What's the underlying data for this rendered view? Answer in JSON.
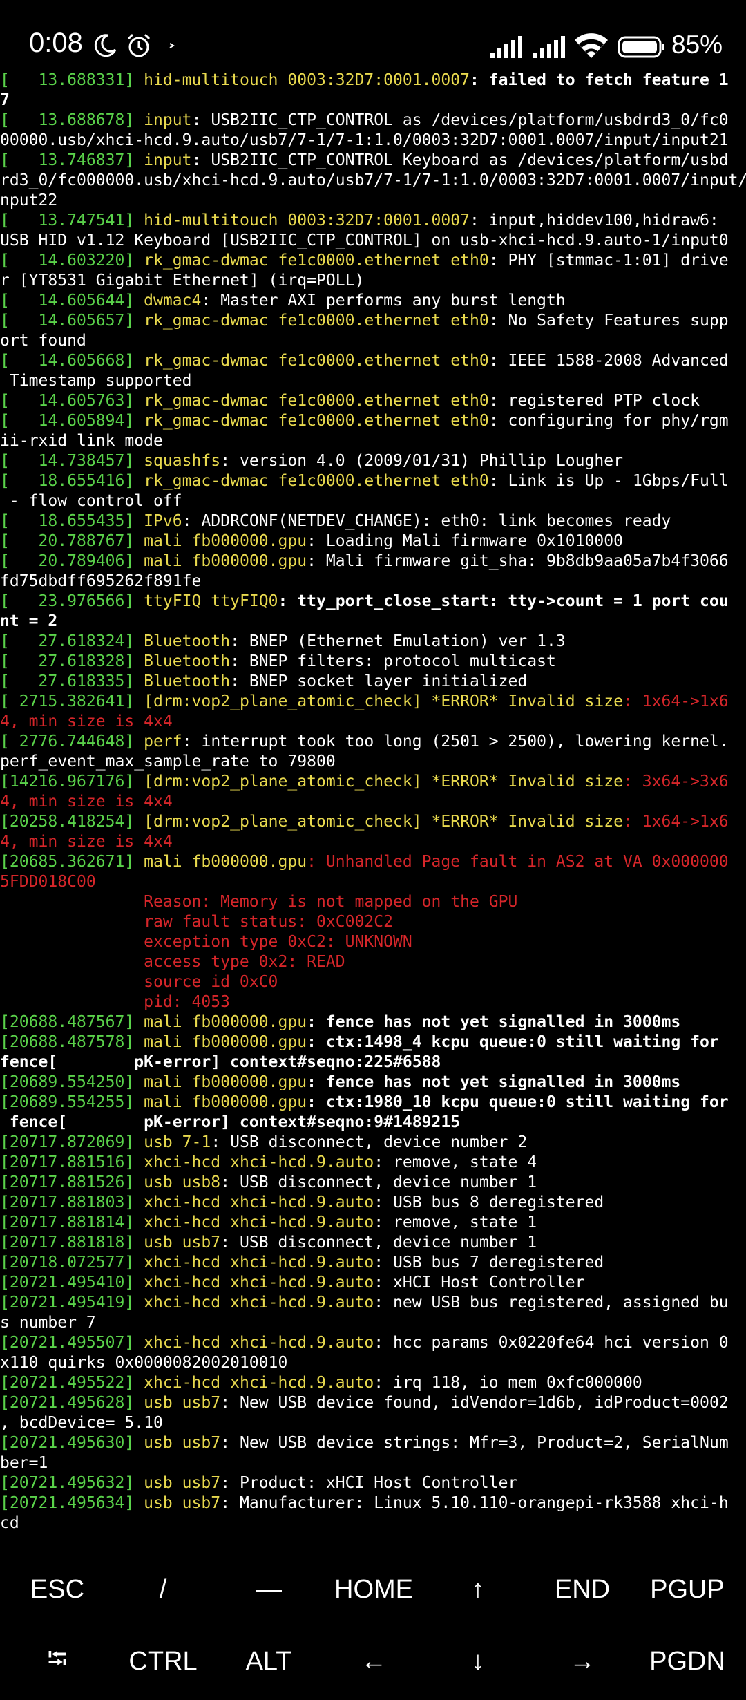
{
  "status_bar": {
    "time": "0:08",
    "battery_percent": "85%",
    "icons": [
      "moon-icon",
      "alarm-icon",
      "notification-dot-icon",
      "signal-1-icon",
      "signal-2-icon",
      "wifi-icon",
      "battery-icon"
    ]
  },
  "colors": {
    "background": "#000000",
    "green": "#5ad24a",
    "yellow": "#e8d94e",
    "red": "#d6262a",
    "white": "#ffffff"
  },
  "terminal": {
    "lines": [
      [
        [
          "g",
          "[   13.688331] "
        ],
        [
          "y",
          "hid-multitouch 0003:32D7:0001.0007"
        ],
        [
          "b",
          ": failed to fetch feature 1"
        ]
      ],
      [
        [
          "b",
          "7"
        ]
      ],
      [
        [
          "g",
          "[   13.688678] "
        ],
        [
          "y",
          "input"
        ],
        [
          "w",
          ": USB2IIC_CTP_CONTROL as /devices/platform/usbdrd3_0/fc0"
        ]
      ],
      [
        [
          "w",
          "00000.usb/xhci-hcd.9.auto/usb7/7-1/7-1:1.0/0003:32D7:0001.0007/input/input21"
        ]
      ],
      [
        [
          "g",
          "[   13.746837] "
        ],
        [
          "y",
          "input"
        ],
        [
          "w",
          ": USB2IIC_CTP_CONTROL Keyboard as /devices/platform/usbd"
        ]
      ],
      [
        [
          "w",
          "rd3_0/fc000000.usb/xhci-hcd.9.auto/usb7/7-1/7-1:1.0/0003:32D7:0001.0007/input/i"
        ]
      ],
      [
        [
          "w",
          "nput22"
        ]
      ],
      [
        [
          "g",
          "[   13.747541] "
        ],
        [
          "y",
          "hid-multitouch 0003:32D7:0001.0007"
        ],
        [
          "w",
          ": input,hiddev100,hidraw6:"
        ]
      ],
      [
        [
          "w",
          "USB HID v1.12 Keyboard [USB2IIC_CTP_CONTROL] on usb-xhci-hcd.9.auto-1/input0"
        ]
      ],
      [
        [
          "g",
          "[   14.603220] "
        ],
        [
          "y",
          "rk_gmac-dwmac fe1c0000.ethernet eth0"
        ],
        [
          "w",
          ": PHY [stmmac-1:01] drive"
        ]
      ],
      [
        [
          "w",
          "r [YT8531 Gigabit Ethernet] (irq=POLL)"
        ]
      ],
      [
        [
          "g",
          "[   14.605644] "
        ],
        [
          "y",
          "dwmac4"
        ],
        [
          "w",
          ": Master AXI performs any burst length"
        ]
      ],
      [
        [
          "g",
          "[   14.605657] "
        ],
        [
          "y",
          "rk_gmac-dwmac fe1c0000.ethernet eth0"
        ],
        [
          "w",
          ": No Safety Features supp"
        ]
      ],
      [
        [
          "w",
          "ort found"
        ]
      ],
      [
        [
          "g",
          "[   14.605668] "
        ],
        [
          "y",
          "rk_gmac-dwmac fe1c0000.ethernet eth0"
        ],
        [
          "w",
          ": IEEE 1588-2008 Advanced"
        ]
      ],
      [
        [
          "w",
          " Timestamp supported"
        ]
      ],
      [
        [
          "g",
          "[   14.605763] "
        ],
        [
          "y",
          "rk_gmac-dwmac fe1c0000.ethernet eth0"
        ],
        [
          "w",
          ": registered PTP clock"
        ]
      ],
      [
        [
          "g",
          "[   14.605894] "
        ],
        [
          "y",
          "rk_gmac-dwmac fe1c0000.ethernet eth0"
        ],
        [
          "w",
          ": configuring for phy/rgm"
        ]
      ],
      [
        [
          "w",
          "ii-rxid link mode"
        ]
      ],
      [
        [
          "g",
          "[   14.738457] "
        ],
        [
          "y",
          "squashfs"
        ],
        [
          "w",
          ": version 4.0 (2009/01/31) Phillip Lougher"
        ]
      ],
      [
        [
          "g",
          "[   18.655416] "
        ],
        [
          "y",
          "rk_gmac-dwmac fe1c0000.ethernet eth0"
        ],
        [
          "w",
          ": Link is Up - 1Gbps/Full"
        ]
      ],
      [
        [
          "w",
          " - flow control off"
        ]
      ],
      [
        [
          "g",
          "[   18.655435] "
        ],
        [
          "y",
          "IPv6"
        ],
        [
          "w",
          ": ADDRCONF(NETDEV_CHANGE): eth0: link becomes ready"
        ]
      ],
      [
        [
          "g",
          "[   20.788767] "
        ],
        [
          "y",
          "mali fb000000.gpu"
        ],
        [
          "w",
          ": Loading Mali firmware 0x1010000"
        ]
      ],
      [
        [
          "g",
          "[   20.789406] "
        ],
        [
          "y",
          "mali fb000000.gpu"
        ],
        [
          "w",
          ": Mali firmware git_sha: 9b8db9aa05a7b4f3066"
        ]
      ],
      [
        [
          "w",
          "fd75dbdff695262f891fe"
        ]
      ],
      [
        [
          "g",
          "[   23.976566] "
        ],
        [
          "y",
          "ttyFIQ ttyFIQ0"
        ],
        [
          "b",
          ": tty_port_close_start: tty->count = 1 port cou"
        ]
      ],
      [
        [
          "b",
          "nt = 2"
        ]
      ],
      [
        [
          "g",
          "[   27.618324] "
        ],
        [
          "y",
          "Bluetooth"
        ],
        [
          "w",
          ": BNEP (Ethernet Emulation) ver 1.3"
        ]
      ],
      [
        [
          "g",
          "[   27.618328] "
        ],
        [
          "y",
          "Bluetooth"
        ],
        [
          "w",
          ": BNEP filters: protocol multicast"
        ]
      ],
      [
        [
          "g",
          "[   27.618335] "
        ],
        [
          "y",
          "Bluetooth"
        ],
        [
          "w",
          ": BNEP socket layer initialized"
        ]
      ],
      [
        [
          "g",
          "[ 2715.382641] "
        ],
        [
          "y",
          "[drm:vop2_plane_atomic_check] *ERROR* Invalid size"
        ],
        [
          "r",
          ": 1x64->1x6"
        ]
      ],
      [
        [
          "r",
          "4, min size is 4x4"
        ]
      ],
      [
        [
          "g",
          "[ 2776.744648] "
        ],
        [
          "y",
          "perf"
        ],
        [
          "w",
          ": interrupt took too long (2501 > 2500), lowering kernel."
        ]
      ],
      [
        [
          "w",
          "perf_event_max_sample_rate to 79800"
        ]
      ],
      [
        [
          "g",
          "[14216.967176] "
        ],
        [
          "y",
          "[drm:vop2_plane_atomic_check] *ERROR* Invalid size"
        ],
        [
          "r",
          ": 3x64->3x6"
        ]
      ],
      [
        [
          "r",
          "4, min size is 4x4"
        ]
      ],
      [
        [
          "g",
          "[20258.418254] "
        ],
        [
          "y",
          "[drm:vop2_plane_atomic_check] *ERROR* Invalid size"
        ],
        [
          "r",
          ": 1x64->1x6"
        ]
      ],
      [
        [
          "r",
          "4, min size is 4x4"
        ]
      ],
      [
        [
          "g",
          "[20685.362671] "
        ],
        [
          "y",
          "mali fb000000.gpu"
        ],
        [
          "r",
          ": Unhandled Page fault in AS2 at VA 0x000000"
        ]
      ],
      [
        [
          "r",
          "5FDD018C00"
        ]
      ],
      [
        [
          "r",
          "               Reason: Memory is not mapped on the GPU"
        ]
      ],
      [
        [
          "r",
          "               raw fault status: 0xC002C2"
        ]
      ],
      [
        [
          "r",
          "               exception type 0xC2: UNKNOWN"
        ]
      ],
      [
        [
          "r",
          "               access type 0x2: READ"
        ]
      ],
      [
        [
          "r",
          "               source id 0xC0"
        ]
      ],
      [
        [
          "r",
          "               pid: 4053"
        ]
      ],
      [
        [
          "g",
          "[20688.487567] "
        ],
        [
          "y",
          "mali fb000000.gpu"
        ],
        [
          "b",
          ": fence has not yet signalled in 3000ms"
        ]
      ],
      [
        [
          "g",
          "[20688.487578] "
        ],
        [
          "y",
          "mali fb000000.gpu"
        ],
        [
          "b",
          ": ctx:1498_4 kcpu queue:0 still waiting for"
        ]
      ],
      [
        [
          "b",
          "fence[        pK-error] context#seqno:225#6588"
        ]
      ],
      [
        [
          "g",
          "[20689.554250] "
        ],
        [
          "y",
          "mali fb000000.gpu"
        ],
        [
          "b",
          ": fence has not yet signalled in 3000ms"
        ]
      ],
      [
        [
          "g",
          "[20689.554255] "
        ],
        [
          "y",
          "mali fb000000.gpu"
        ],
        [
          "b",
          ": ctx:1980_10 kcpu queue:0 still waiting for"
        ]
      ],
      [
        [
          "b",
          " fence[        pK-error] context#seqno:9#1489215"
        ]
      ],
      [
        [
          "g",
          "[20717.872069] "
        ],
        [
          "y",
          "usb 7-1"
        ],
        [
          "w",
          ": USB disconnect, device number 2"
        ]
      ],
      [
        [
          "g",
          "[20717.881516] "
        ],
        [
          "y",
          "xhci-hcd xhci-hcd.9.auto"
        ],
        [
          "w",
          ": remove, state 4"
        ]
      ],
      [
        [
          "g",
          "[20717.881526] "
        ],
        [
          "y",
          "usb usb8"
        ],
        [
          "w",
          ": USB disconnect, device number 1"
        ]
      ],
      [
        [
          "g",
          "[20717.881803] "
        ],
        [
          "y",
          "xhci-hcd xhci-hcd.9.auto"
        ],
        [
          "w",
          ": USB bus 8 deregistered"
        ]
      ],
      [
        [
          "g",
          "[20717.881814] "
        ],
        [
          "y",
          "xhci-hcd xhci-hcd.9.auto"
        ],
        [
          "w",
          ": remove, state 1"
        ]
      ],
      [
        [
          "g",
          "[20717.881818] "
        ],
        [
          "y",
          "usb usb7"
        ],
        [
          "w",
          ": USB disconnect, device number 1"
        ]
      ],
      [
        [
          "g",
          "[20718.072577] "
        ],
        [
          "y",
          "xhci-hcd xhci-hcd.9.auto"
        ],
        [
          "w",
          ": USB bus 7 deregistered"
        ]
      ],
      [
        [
          "g",
          "[20721.495410] "
        ],
        [
          "y",
          "xhci-hcd xhci-hcd.9.auto"
        ],
        [
          "w",
          ": xHCI Host Controller"
        ]
      ],
      [
        [
          "g",
          "[20721.495419] "
        ],
        [
          "y",
          "xhci-hcd xhci-hcd.9.auto"
        ],
        [
          "w",
          ": new USB bus registered, assigned bu"
        ]
      ],
      [
        [
          "w",
          "s number 7"
        ]
      ],
      [
        [
          "g",
          "[20721.495507] "
        ],
        [
          "y",
          "xhci-hcd xhci-hcd.9.auto"
        ],
        [
          "w",
          ": hcc params 0x0220fe64 hci version 0"
        ]
      ],
      [
        [
          "w",
          "x110 quirks 0x0000082002010010"
        ]
      ],
      [
        [
          "g",
          "[20721.495522] "
        ],
        [
          "y",
          "xhci-hcd xhci-hcd.9.auto"
        ],
        [
          "w",
          ": irq 118, io mem 0xfc000000"
        ]
      ],
      [
        [
          "g",
          "[20721.495628] "
        ],
        [
          "y",
          "usb usb7"
        ],
        [
          "w",
          ": New USB device found, idVendor=1d6b, idProduct=0002"
        ]
      ],
      [
        [
          "w",
          ", bcdDevice= 5.10"
        ]
      ],
      [
        [
          "g",
          "[20721.495630] "
        ],
        [
          "y",
          "usb usb7"
        ],
        [
          "w",
          ": New USB device strings: Mfr=3, Product=2, SerialNum"
        ]
      ],
      [
        [
          "w",
          "ber=1"
        ]
      ],
      [
        [
          "g",
          "[20721.495632] "
        ],
        [
          "y",
          "usb usb7"
        ],
        [
          "w",
          ": Product: xHCI Host Controller"
        ]
      ],
      [
        [
          "g",
          "[20721.495634] "
        ],
        [
          "y",
          "usb usb7"
        ],
        [
          "w",
          ": Manufacturer: Linux 5.10.110-orangepi-rk3588 xhci-h"
        ]
      ],
      [
        [
          "w",
          "cd"
        ]
      ]
    ]
  },
  "extra_keys": {
    "row1": [
      {
        "name": "esc-key",
        "label": "ESC"
      },
      {
        "name": "slash-key",
        "label": "/"
      },
      {
        "name": "dash-key",
        "label": "—"
      },
      {
        "name": "home-key",
        "label": "HOME"
      },
      {
        "name": "up-arrow-key",
        "label": "↑"
      },
      {
        "name": "end-key",
        "label": "END"
      },
      {
        "name": "pgup-key",
        "label": "PGUP"
      }
    ],
    "row2": [
      {
        "name": "tab-key",
        "label": "⭾"
      },
      {
        "name": "ctrl-key",
        "label": "CTRL"
      },
      {
        "name": "alt-key",
        "label": "ALT"
      },
      {
        "name": "left-arrow-key",
        "label": "←"
      },
      {
        "name": "down-arrow-key",
        "label": "↓"
      },
      {
        "name": "right-arrow-key",
        "label": "→"
      },
      {
        "name": "pgdn-key",
        "label": "PGDN"
      }
    ]
  }
}
